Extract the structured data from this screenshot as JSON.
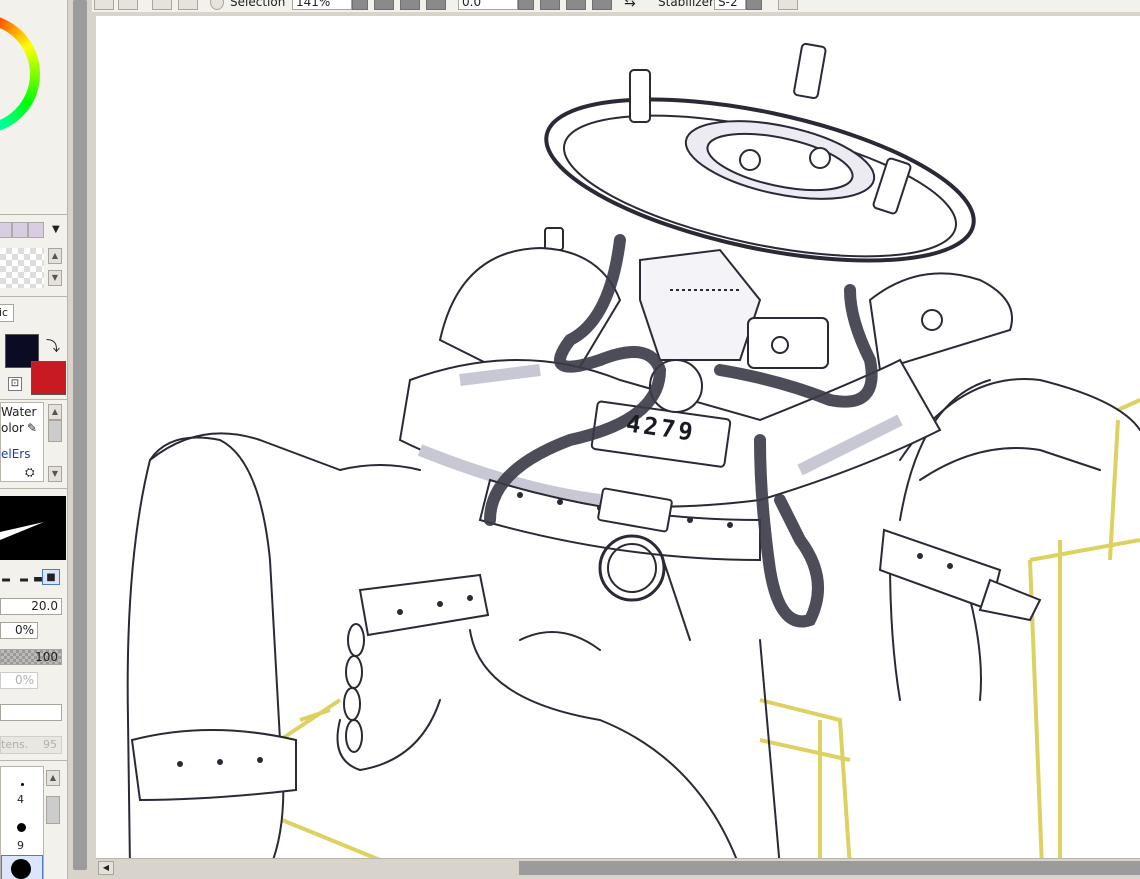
{
  "toolbar": {
    "selection_label": "Selection",
    "zoom_value": "141%",
    "angle_value": "0.0",
    "stabilizer_label": "Stabilizer",
    "stabilizer_value": "S-2"
  },
  "left_panel": {
    "mode_tab_label": "ic",
    "brush_name_line1": "Water",
    "brush_name_line2": "olor",
    "brush_preset_label": "elErs",
    "primary_color": "#0b0b24",
    "secondary_color": "#c81a22",
    "max_size_value": "20.0",
    "min_size_value": "0%",
    "density_value": "100",
    "blending_value": "0%",
    "intensity_label": "tens.",
    "intensity_value": "95",
    "size_presets": [
      "4",
      "9"
    ]
  },
  "canvas": {
    "stamp_number": "4279"
  }
}
